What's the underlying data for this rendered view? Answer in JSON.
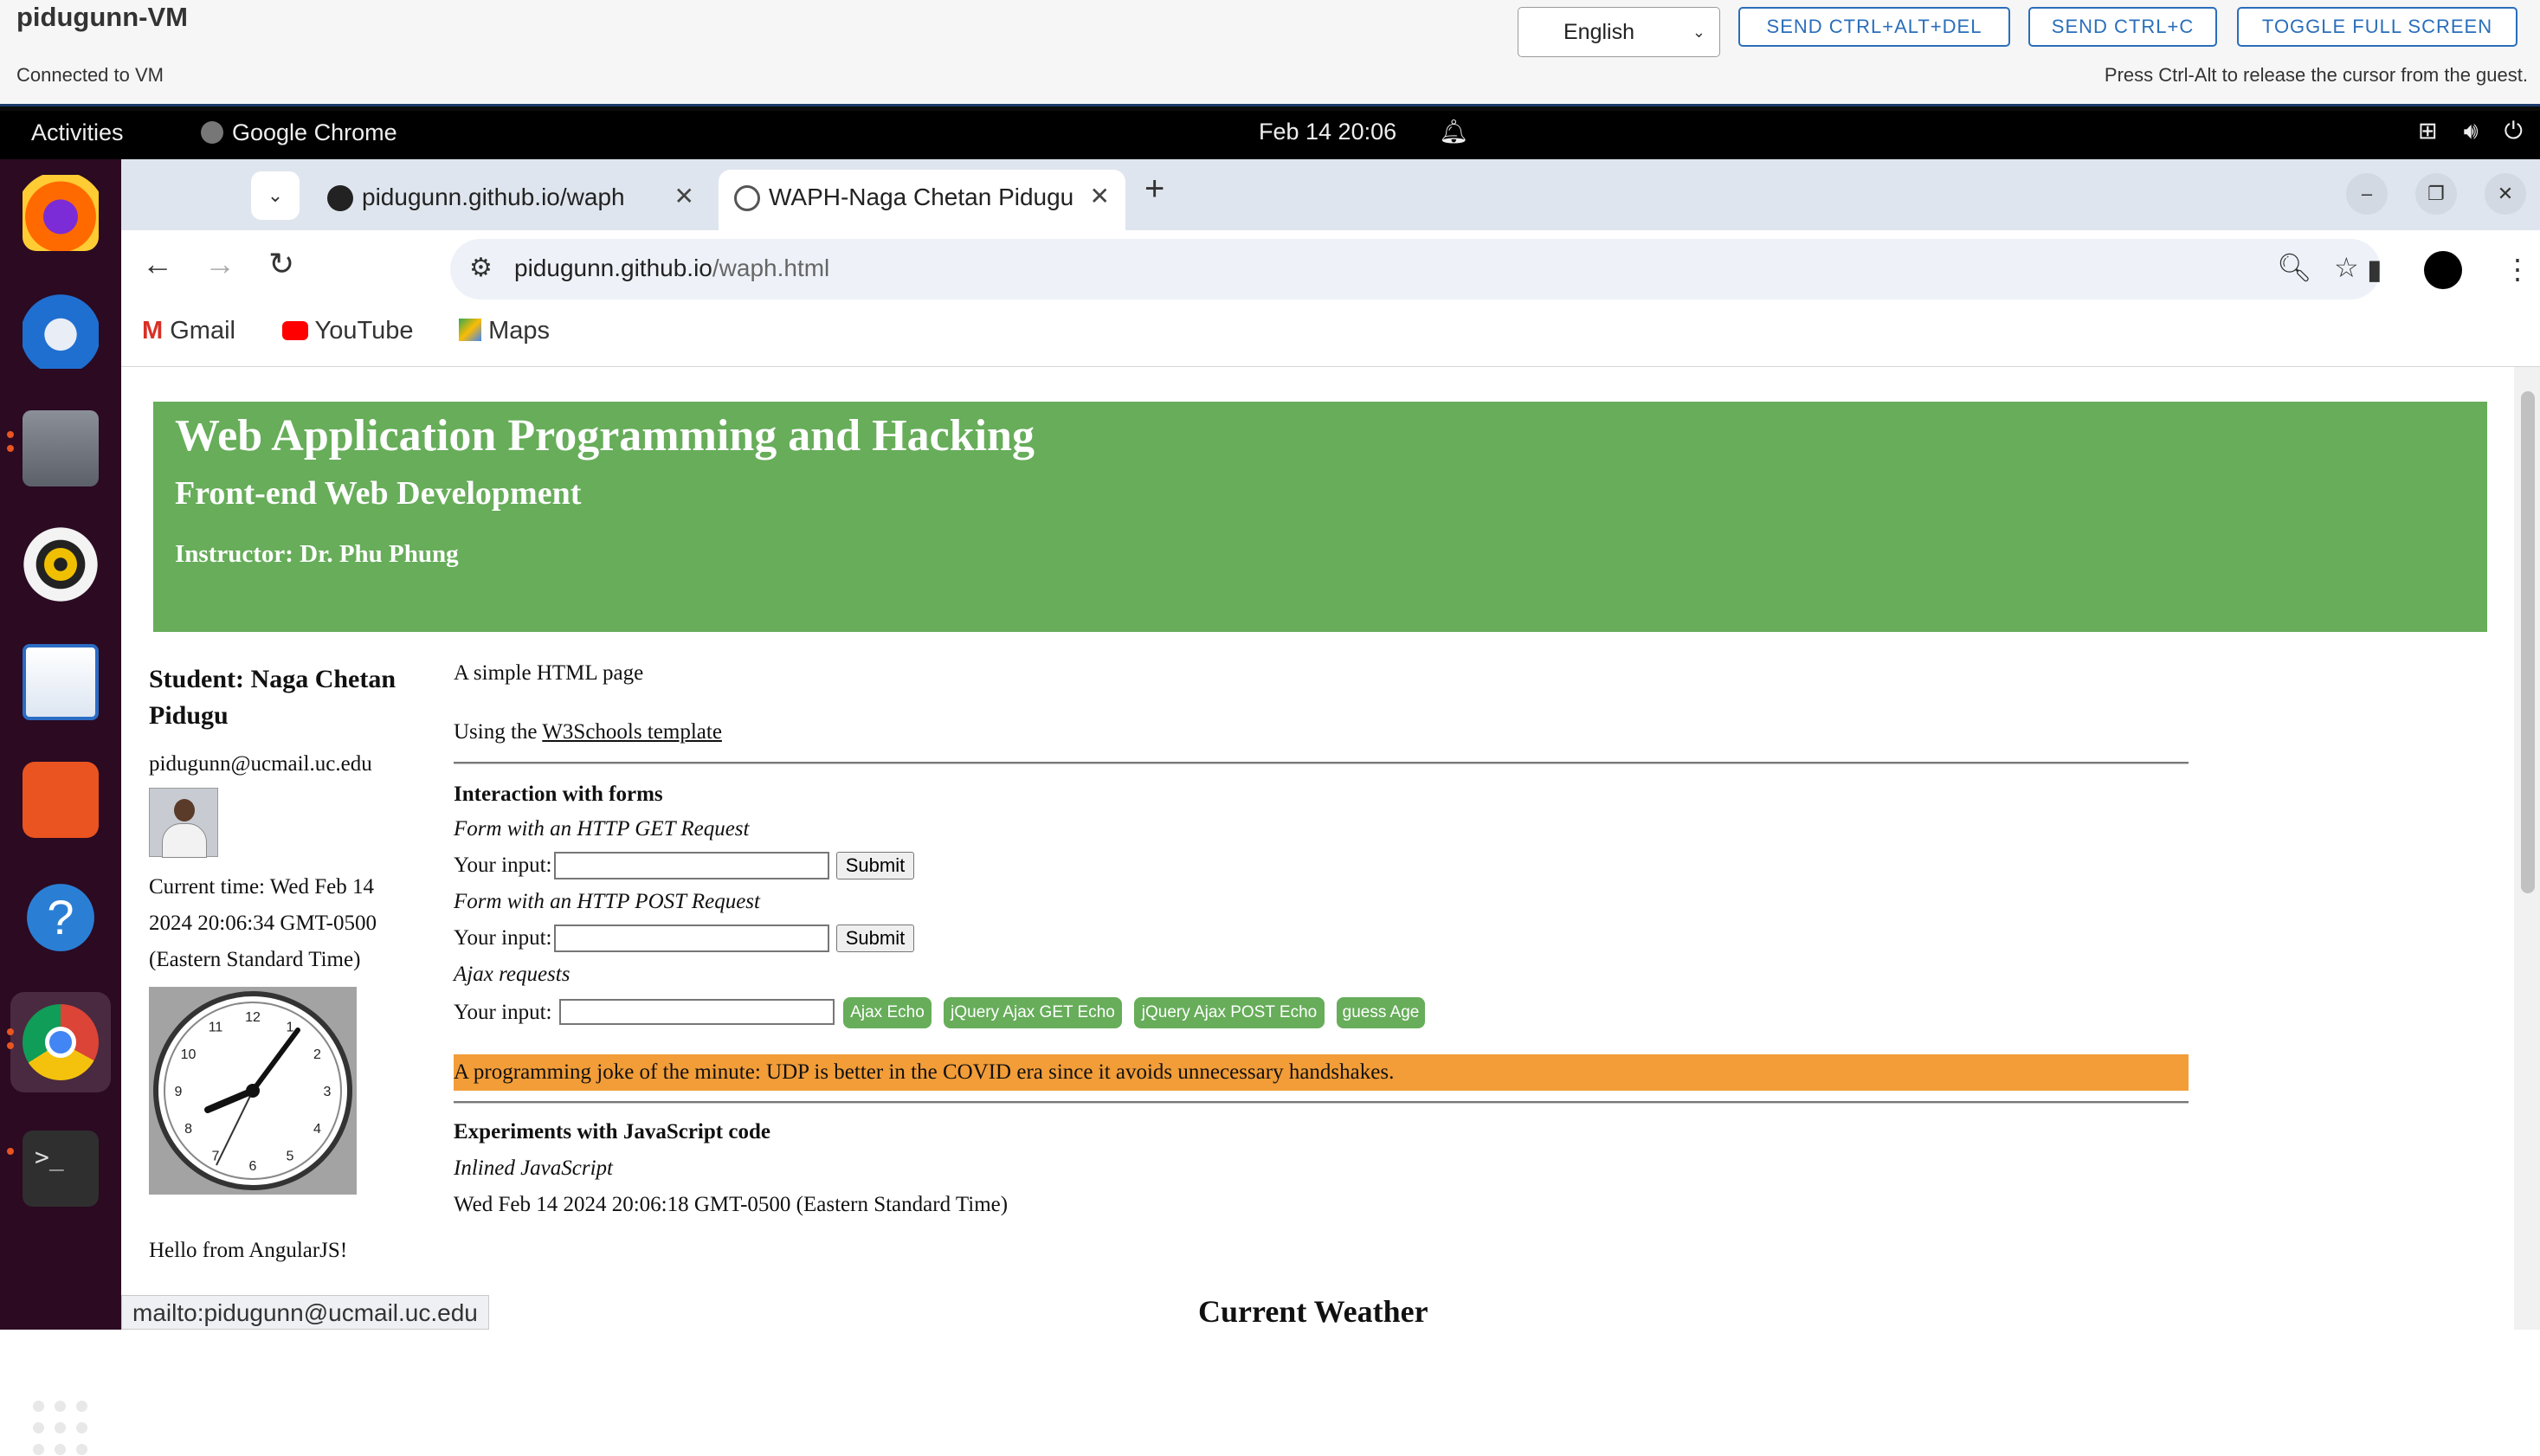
{
  "vm": {
    "title": "pidugunn-VM",
    "status": "Connected to VM",
    "hint": "Press Ctrl-Alt to release the cursor from the guest.",
    "language": "English",
    "buttons": [
      "SEND CTRL+ALT+DEL",
      "SEND CTRL+C",
      "TOGGLE FULL SCREEN"
    ]
  },
  "topbar": {
    "activities": "Activities",
    "app": "Google Chrome",
    "clock": "Feb 14  20:06"
  },
  "dock": {
    "apps": [
      "firefox-icon",
      "thunderbird-icon",
      "files-icon",
      "rhythmbox-icon",
      "writer-icon",
      "app-center-icon",
      "help-icon",
      "chrome-icon",
      "terminal-icon"
    ],
    "running": [
      "files-icon",
      "chrome-icon",
      "terminal-icon"
    ]
  },
  "tabs": [
    {
      "title": "pidugunn.github.io/waph",
      "active": false
    },
    {
      "title": "WAPH-Naga Chetan Pidugu",
      "active": true
    }
  ],
  "toolbar": {
    "url_host": "pidugunn.github.io",
    "url_path": "/waph.html"
  },
  "bookmarks": [
    "Gmail",
    "YouTube",
    "Maps"
  ],
  "page": {
    "banner_title": "Web Application Programming and Hacking",
    "banner_subtitle": "Front-end Web Development",
    "banner_instructor": "Instructor: Dr. Phu Phung",
    "student": "Student: Naga Chetan Pidugu",
    "email": "pidugunn@ucmail.uc.edu",
    "current_time": "Current time: Wed Feb 14 2024 20:06:34 GMT-0500 (Eastern Standard Time)",
    "hello": "Hello from AngularJS!",
    "intro": "A simple HTML page",
    "using_prefix": "Using the ",
    "using_link": "W3Schools template",
    "forms_heading": "Interaction with forms",
    "get_label": "Form with an HTTP GET Request",
    "post_label": "Form with an HTTP POST Request",
    "ajax_label": "Ajax requests",
    "input_label": "Your input:",
    "submit": "Submit",
    "ajax_buttons": [
      "Ajax Echo",
      "jQuery Ajax GET Echo",
      "jQuery Ajax POST Echo",
      "guess Age"
    ],
    "joke": "A programming joke of the minute: UDP is better in the COVID era since it avoids unnecessary handshakes.",
    "js_heading": "Experiments with JavaScript code",
    "inline_label": "Inlined JavaScript",
    "inline_output": "Wed Feb 14 2024 20:06:18 GMT-0500 (Eastern Standard Time)",
    "weather": "Current Weather"
  },
  "clock_numbers": [
    "12",
    "1",
    "2",
    "3",
    "4",
    "5",
    "6",
    "7",
    "8",
    "9",
    "10",
    "11"
  ],
  "status_link": "mailto:pidugunn@ucmail.uc.edu",
  "colors": {
    "banner": "#67ad5a",
    "joke": "#f29d38",
    "dock": "#2b0a22",
    "accent": "#2a6ebb"
  }
}
